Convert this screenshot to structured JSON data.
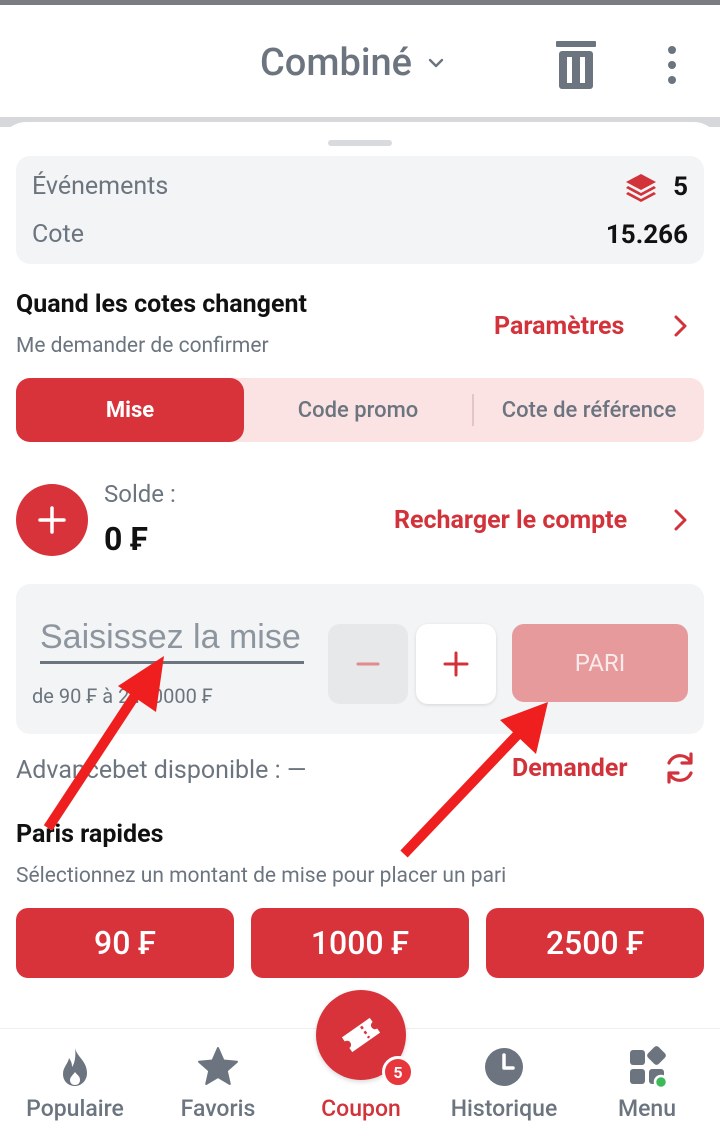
{
  "header": {
    "title": "Combiné",
    "icons": [
      "chevron-down-icon",
      "trash-icon",
      "more-vertical-icon"
    ]
  },
  "summary": {
    "events_label": "Événements",
    "events_count": "5",
    "odds_label": "Cote",
    "odds_value": "15.266"
  },
  "odds_change": {
    "title": "Quand les cotes changent",
    "subtitle": "Me demander de confirmer",
    "settings_link": "Paramètres"
  },
  "tabs": [
    {
      "label": "Mise",
      "active": true
    },
    {
      "label": "Code promo",
      "active": false
    },
    {
      "label": "Cote de référence",
      "active": false
    }
  ],
  "balance": {
    "label": "Solde :",
    "value": "0 ₣",
    "recharge_link": "Recharger le compte"
  },
  "stake": {
    "placeholder": "Saisissez la mise",
    "range": "de 90 ₣ à 2400000 ₣",
    "minus": "−",
    "plus": "+",
    "bet_button": "PARI"
  },
  "advancebet": {
    "label": "Advancebet disponible : —",
    "request_link": "Demander"
  },
  "quick_bets": {
    "title": "Paris rapides",
    "subtitle": "Sélectionnez un montant de mise pour placer un pari",
    "amounts": [
      "90 ₣",
      "1000 ₣",
      "2500 ₣"
    ]
  },
  "bottom_nav": {
    "items": [
      {
        "label": "Populaire",
        "icon": "flame-icon"
      },
      {
        "label": "Favoris",
        "icon": "star-icon"
      },
      {
        "label": "Coupon",
        "icon": "ticket-icon",
        "active": true
      },
      {
        "label": "Historique",
        "icon": "clock-icon"
      },
      {
        "label": "Menu",
        "icon": "grid-icon"
      }
    ],
    "coupon_badge": "5"
  },
  "colors": {
    "accent": "#d8333b",
    "accent_light": "#fbe3e4",
    "text_muted": "#6c757f",
    "surface": "#f2f4f5",
    "disabled_button": "#e69a9c"
  }
}
